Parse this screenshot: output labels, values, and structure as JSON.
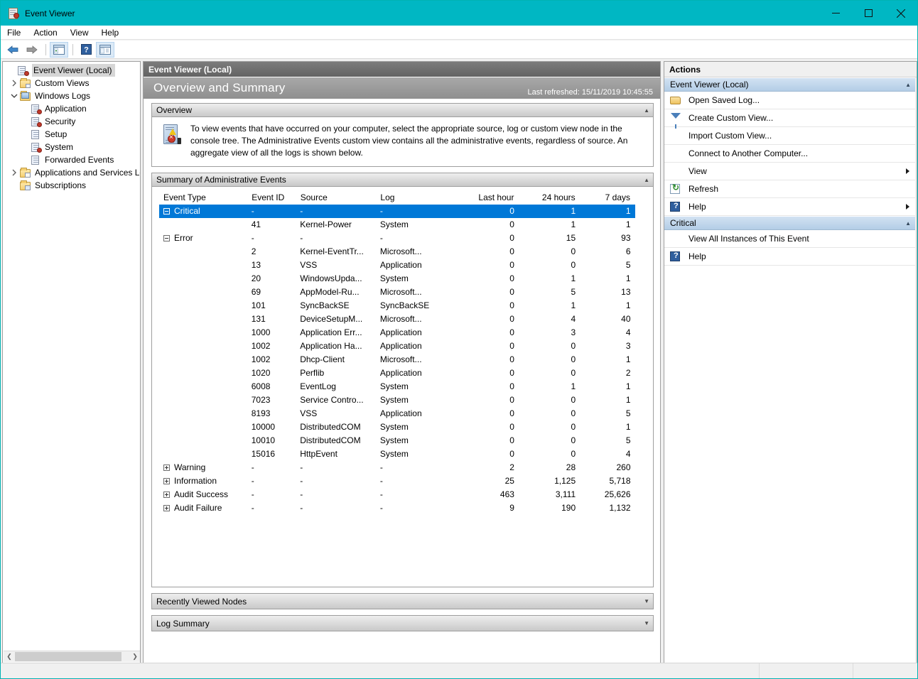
{
  "window": {
    "title": "Event Viewer",
    "icon": "event-viewer-icon",
    "controls": {
      "minimize": "minimize-icon",
      "maximize": "maximize-icon",
      "close": "close-icon"
    },
    "accent_color": "#00b7c3"
  },
  "menubar": {
    "items": [
      "File",
      "Action",
      "View",
      "Help"
    ]
  },
  "toolbar": {
    "buttons": [
      {
        "name": "back-button",
        "icon": "back-arrow-icon"
      },
      {
        "name": "forward-button",
        "icon": "forward-arrow-icon"
      },
      {
        "name": "show-hide-console-tree-button",
        "icon": "console-tree-icon"
      },
      {
        "name": "help-button",
        "icon": "help-icon"
      },
      {
        "name": "show-hide-action-pane-button",
        "icon": "action-pane-icon"
      }
    ]
  },
  "tree": {
    "items": [
      {
        "label": "Event Viewer (Local)",
        "icon": "event-viewer-icon",
        "indent": 0,
        "expander": "",
        "selected": true
      },
      {
        "label": "Custom Views",
        "icon": "custom-views-folder-icon",
        "indent": 1,
        "expander": "collapsed",
        "selected": false
      },
      {
        "label": "Windows Logs",
        "icon": "windows-logs-folder-icon",
        "indent": 1,
        "expander": "expanded",
        "selected": false
      },
      {
        "label": "Application",
        "icon": "log-error-icon",
        "indent": 2,
        "expander": "",
        "selected": false
      },
      {
        "label": "Security",
        "icon": "log-error-icon",
        "indent": 2,
        "expander": "",
        "selected": false
      },
      {
        "label": "Setup",
        "icon": "log-icon",
        "indent": 2,
        "expander": "",
        "selected": false
      },
      {
        "label": "System",
        "icon": "log-error-icon",
        "indent": 2,
        "expander": "",
        "selected": false
      },
      {
        "label": "Forwarded Events",
        "icon": "log-icon",
        "indent": 2,
        "expander": "",
        "selected": false
      },
      {
        "label": "Applications and Services Lo",
        "icon": "services-folder-icon",
        "indent": 1,
        "expander": "collapsed",
        "selected": false
      },
      {
        "label": "Subscriptions",
        "icon": "subscriptions-folder-icon",
        "indent": 1,
        "expander": "",
        "selected": false
      }
    ]
  },
  "center": {
    "breadcrumb": "Event Viewer (Local)",
    "page_title": "Overview and Summary",
    "last_refreshed": "Last refreshed: 15/11/2019 10:45:55",
    "overview": {
      "header": "Overview",
      "caret": "collapse-caret",
      "text": "To view events that have occurred on your computer, select the appropriate source, log or custom view node in the console tree. The Administrative Events custom view contains all the administrative events, regardless of source. An aggregate view of all the logs is shown below."
    },
    "summary": {
      "header": "Summary of Administrative Events",
      "caret": "collapse-caret",
      "columns": [
        "Event Type",
        "Event ID",
        "Source",
        "Log",
        "Last hour",
        "24 hours",
        "7 days"
      ],
      "rows": [
        {
          "type": "group",
          "expander": "minus",
          "event_type": "Critical",
          "event_id": "-",
          "source": "-",
          "log": "-",
          "last_hour": "0",
          "hours24": "1",
          "days7": "1",
          "selected": true
        },
        {
          "type": "child",
          "expander": "",
          "event_type": "",
          "event_id": "41",
          "source": "Kernel-Power",
          "log": "System",
          "last_hour": "0",
          "hours24": "1",
          "days7": "1",
          "selected": false
        },
        {
          "type": "group",
          "expander": "minus",
          "event_type": "Error",
          "event_id": "-",
          "source": "-",
          "log": "-",
          "last_hour": "0",
          "hours24": "15",
          "days7": "93",
          "selected": false
        },
        {
          "type": "child",
          "expander": "",
          "event_type": "",
          "event_id": "2",
          "source": "Kernel-EventTr...",
          "log": "Microsoft...",
          "last_hour": "0",
          "hours24": "0",
          "days7": "6",
          "selected": false
        },
        {
          "type": "child",
          "expander": "",
          "event_type": "",
          "event_id": "13",
          "source": "VSS",
          "log": "Application",
          "last_hour": "0",
          "hours24": "0",
          "days7": "5",
          "selected": false
        },
        {
          "type": "child",
          "expander": "",
          "event_type": "",
          "event_id": "20",
          "source": "WindowsUpda...",
          "log": "System",
          "last_hour": "0",
          "hours24": "1",
          "days7": "1",
          "selected": false
        },
        {
          "type": "child",
          "expander": "",
          "event_type": "",
          "event_id": "69",
          "source": "AppModel-Ru...",
          "log": "Microsoft...",
          "last_hour": "0",
          "hours24": "5",
          "days7": "13",
          "selected": false
        },
        {
          "type": "child",
          "expander": "",
          "event_type": "",
          "event_id": "101",
          "source": "SyncBackSE",
          "log": "SyncBackSE",
          "last_hour": "0",
          "hours24": "1",
          "days7": "1",
          "selected": false
        },
        {
          "type": "child",
          "expander": "",
          "event_type": "",
          "event_id": "131",
          "source": "DeviceSetupM...",
          "log": "Microsoft...",
          "last_hour": "0",
          "hours24": "4",
          "days7": "40",
          "selected": false
        },
        {
          "type": "child",
          "expander": "",
          "event_type": "",
          "event_id": "1000",
          "source": "Application Err...",
          "log": "Application",
          "last_hour": "0",
          "hours24": "3",
          "days7": "4",
          "selected": false
        },
        {
          "type": "child",
          "expander": "",
          "event_type": "",
          "event_id": "1002",
          "source": "Application Ha...",
          "log": "Application",
          "last_hour": "0",
          "hours24": "0",
          "days7": "3",
          "selected": false
        },
        {
          "type": "child",
          "expander": "",
          "event_type": "",
          "event_id": "1002",
          "source": "Dhcp-Client",
          "log": "Microsoft...",
          "last_hour": "0",
          "hours24": "0",
          "days7": "1",
          "selected": false
        },
        {
          "type": "child",
          "expander": "",
          "event_type": "",
          "event_id": "1020",
          "source": "Perflib",
          "log": "Application",
          "last_hour": "0",
          "hours24": "0",
          "days7": "2",
          "selected": false
        },
        {
          "type": "child",
          "expander": "",
          "event_type": "",
          "event_id": "6008",
          "source": "EventLog",
          "log": "System",
          "last_hour": "0",
          "hours24": "1",
          "days7": "1",
          "selected": false
        },
        {
          "type": "child",
          "expander": "",
          "event_type": "",
          "event_id": "7023",
          "source": "Service Contro...",
          "log": "System",
          "last_hour": "0",
          "hours24": "0",
          "days7": "1",
          "selected": false
        },
        {
          "type": "child",
          "expander": "",
          "event_type": "",
          "event_id": "8193",
          "source": "VSS",
          "log": "Application",
          "last_hour": "0",
          "hours24": "0",
          "days7": "5",
          "selected": false
        },
        {
          "type": "child",
          "expander": "",
          "event_type": "",
          "event_id": "10000",
          "source": "DistributedCOM",
          "log": "System",
          "last_hour": "0",
          "hours24": "0",
          "days7": "1",
          "selected": false
        },
        {
          "type": "child",
          "expander": "",
          "event_type": "",
          "event_id": "10010",
          "source": "DistributedCOM",
          "log": "System",
          "last_hour": "0",
          "hours24": "0",
          "days7": "5",
          "selected": false
        },
        {
          "type": "child",
          "expander": "",
          "event_type": "",
          "event_id": "15016",
          "source": "HttpEvent",
          "log": "System",
          "last_hour": "0",
          "hours24": "0",
          "days7": "4",
          "selected": false
        },
        {
          "type": "group",
          "expander": "plus",
          "event_type": "Warning",
          "event_id": "-",
          "source": "-",
          "log": "-",
          "last_hour": "2",
          "hours24": "28",
          "days7": "260",
          "selected": false
        },
        {
          "type": "group",
          "expander": "plus",
          "event_type": "Information",
          "event_id": "-",
          "source": "-",
          "log": "-",
          "last_hour": "25",
          "hours24": "1,125",
          "days7": "5,718",
          "selected": false
        },
        {
          "type": "group",
          "expander": "plus",
          "event_type": "Audit Success",
          "event_id": "-",
          "source": "-",
          "log": "-",
          "last_hour": "463",
          "hours24": "3,111",
          "days7": "25,626",
          "selected": false
        },
        {
          "type": "group",
          "expander": "plus",
          "event_type": "Audit Failure",
          "event_id": "-",
          "source": "-",
          "log": "-",
          "last_hour": "9",
          "hours24": "190",
          "days7": "1,132",
          "selected": false
        }
      ]
    },
    "recently_viewed": {
      "header": "Recently Viewed Nodes",
      "caret": "expand-caret"
    },
    "log_summary": {
      "header": "Log Summary",
      "caret": "expand-caret"
    }
  },
  "actions": {
    "title": "Actions",
    "groups": [
      {
        "header": "Event Viewer (Local)",
        "caret": "collapse-caret",
        "items": [
          {
            "label": "Open Saved Log...",
            "icon": "open-folder-icon",
            "submenu": false
          },
          {
            "label": "Create Custom View...",
            "icon": "funnel-icon",
            "submenu": false
          },
          {
            "label": "Import Custom View...",
            "icon": "",
            "submenu": false
          },
          {
            "label": "Connect to Another Computer...",
            "icon": "",
            "submenu": false
          },
          {
            "label": "View",
            "icon": "",
            "submenu": true
          },
          {
            "label": "Refresh",
            "icon": "refresh-icon",
            "submenu": false
          },
          {
            "label": "Help",
            "icon": "help-icon",
            "submenu": true
          }
        ]
      },
      {
        "header": "Critical",
        "caret": "collapse-caret",
        "items": [
          {
            "label": "View All Instances of This Event",
            "icon": "",
            "submenu": false
          },
          {
            "label": "Help",
            "icon": "help-icon",
            "submenu": false
          }
        ]
      }
    ]
  },
  "statusbar": {
    "cells": [
      "",
      "",
      ""
    ]
  }
}
